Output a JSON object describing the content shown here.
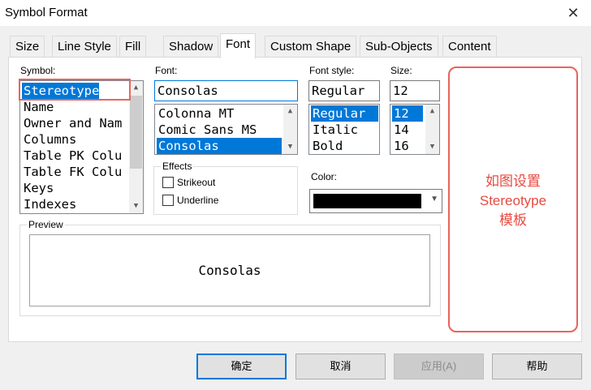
{
  "window": {
    "title": "Symbol Format",
    "close_glyph": "✕"
  },
  "tabs": [
    "Size",
    "Line Style",
    "Fill",
    "Shadow",
    "Font",
    "Custom Shape",
    "Sub-Objects",
    "Content"
  ],
  "active_tab": "Font",
  "symbol": {
    "label": "Symbol:",
    "items": [
      "Stereotype",
      "Name",
      "Owner and Nam",
      "Columns",
      "Table PK Colu",
      "Table FK Colu",
      "Keys",
      "Indexes"
    ],
    "selected": "Stereotype"
  },
  "font": {
    "label": "Font:",
    "value": "Consolas",
    "items": [
      "Colonna MT",
      "Comic Sans MS",
      "Consolas"
    ],
    "selected": "Consolas"
  },
  "font_style": {
    "label": "Font style:",
    "value": "Regular",
    "items": [
      "Regular",
      "Italic",
      "Bold"
    ],
    "selected": "Regular"
  },
  "size": {
    "label": "Size:",
    "value": "12",
    "items": [
      "12",
      "14",
      "16"
    ],
    "selected": "12"
  },
  "effects": {
    "title": "Effects",
    "strikeout": {
      "label": "Strikeout",
      "checked": false
    },
    "underline": {
      "label": "Underline",
      "checked": false
    }
  },
  "color": {
    "label": "Color:",
    "value_hex": "#000000"
  },
  "preview": {
    "title": "Preview",
    "sample": "Consolas"
  },
  "annotation": {
    "line1": "如图设置",
    "line2": "Stereotype",
    "line3": "模板",
    "color": "#e84a40"
  },
  "buttons": {
    "ok": "确定",
    "cancel": "取消",
    "apply": "应用(A)",
    "help": "帮助"
  }
}
